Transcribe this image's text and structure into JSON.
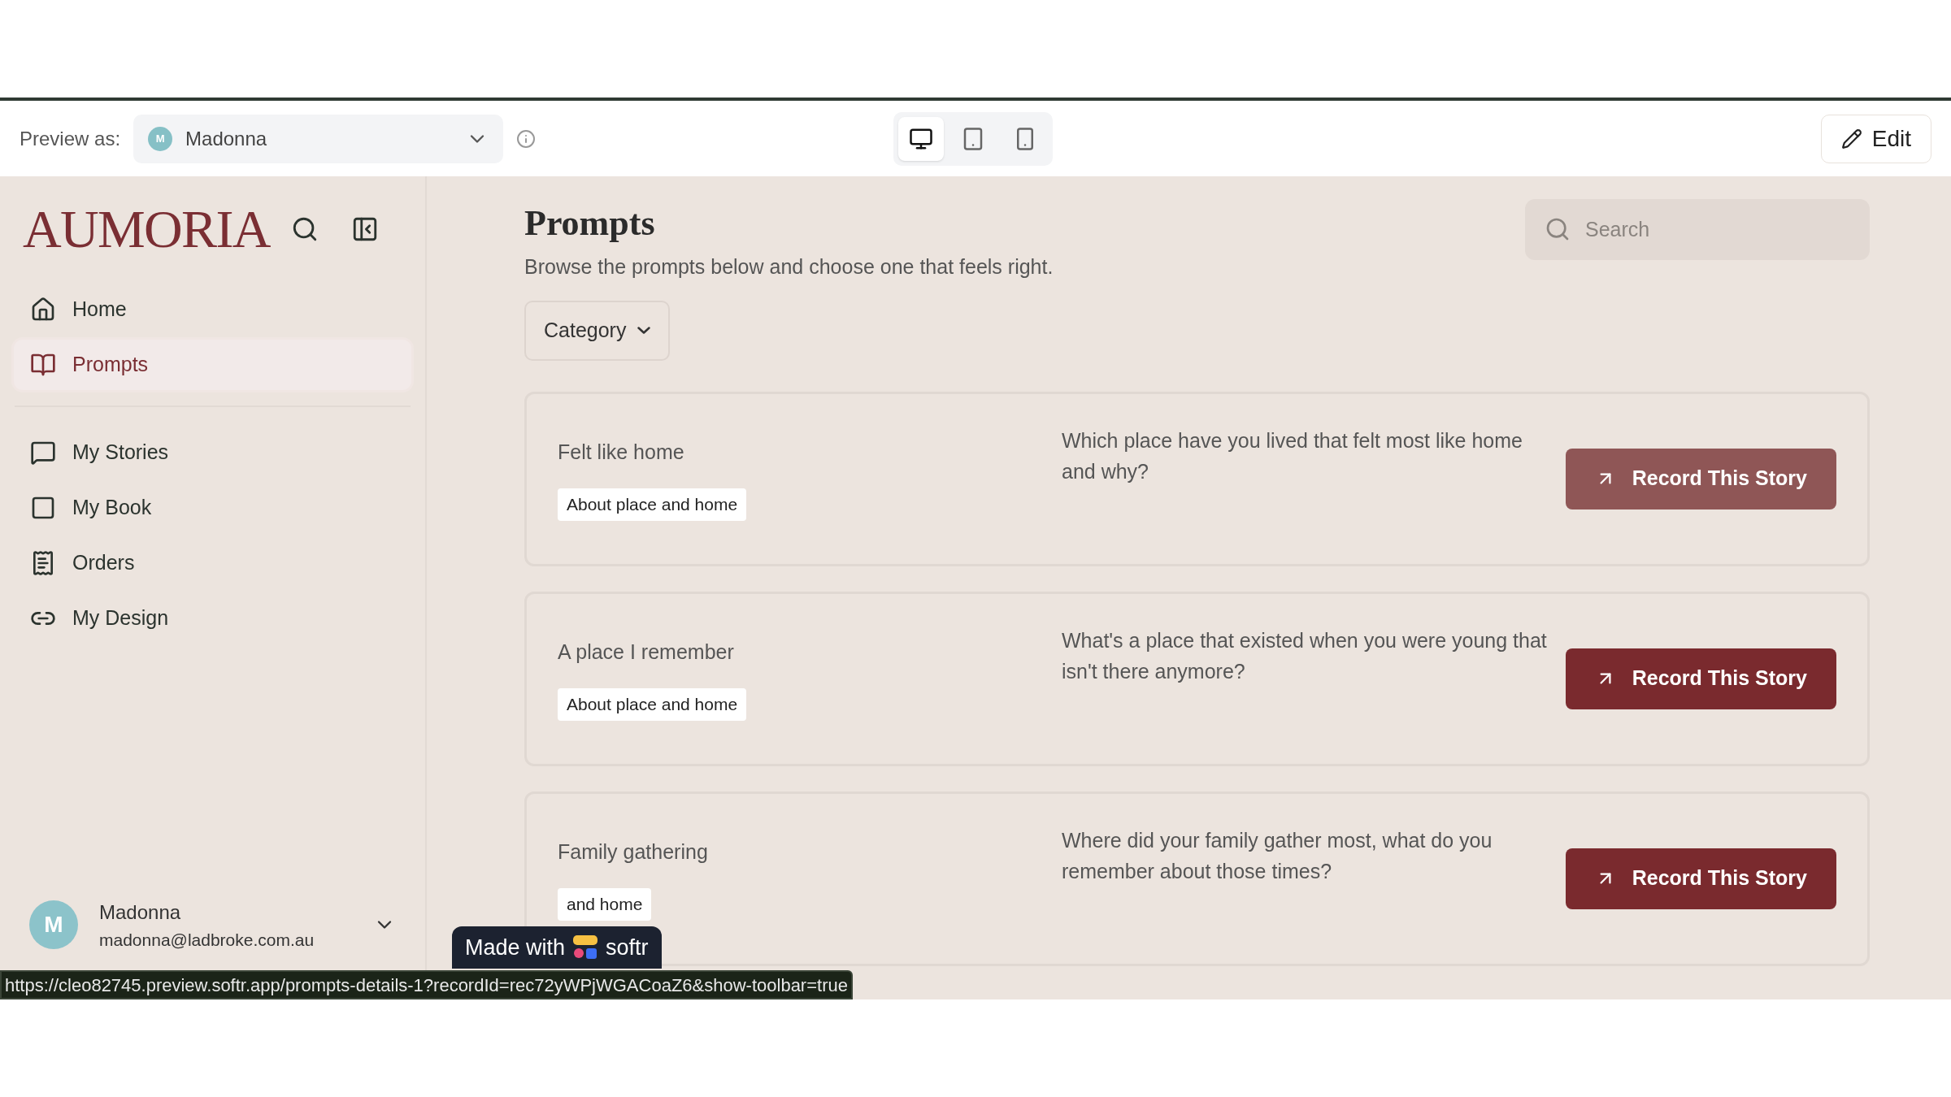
{
  "toolbar": {
    "preview_label": "Preview as:",
    "user_select": {
      "initial": "M",
      "name": "Madonna"
    },
    "devices": [
      {
        "kind": "desktop",
        "selected": true
      },
      {
        "kind": "tablet",
        "selected": false
      },
      {
        "kind": "phone",
        "selected": false
      }
    ],
    "edit_button": "Edit"
  },
  "sidebar": {
    "logo": "AUMORIA",
    "items": [
      {
        "label": "Home",
        "kind": "home",
        "selected": false
      },
      {
        "label": "Prompts",
        "kind": "book",
        "selected": true
      },
      {
        "label": "My Stories",
        "kind": "chat",
        "selected": false
      },
      {
        "label": "My Book",
        "kind": "square",
        "selected": false
      },
      {
        "label": "Orders",
        "kind": "receipt",
        "selected": false
      },
      {
        "label": "My Design",
        "kind": "link",
        "selected": false
      }
    ],
    "user": {
      "initial": "M",
      "name": "Madonna",
      "email": "madonna@ladbroke.com.au"
    }
  },
  "main": {
    "title": "Prompts",
    "subtitle": "Browse the prompts below and choose one that feels right.",
    "search": {
      "placeholder": "Search"
    },
    "category_button": "Category",
    "cards": [
      {
        "title": "Felt like home",
        "tag": "About place and home",
        "question": "Which place have you lived that felt most like home and why?",
        "button": "Record This Story",
        "hovered": true
      },
      {
        "title": "A place I remember",
        "tag": "About place and home",
        "question": "What's a place that existed when you were young that isn't there anymore?",
        "button": "Record This Story",
        "hovered": false
      },
      {
        "title": "Family gathering",
        "tag": "and home",
        "question": "Where did your family gather most, what do you remember about those times?",
        "button": "Record This Story",
        "hovered": false
      }
    ]
  },
  "badge": {
    "prefix": "Made with",
    "brand": "softr"
  },
  "status_url": "https://cleo82745.preview.softr.app/prompts-details-1?recordId=rec72yWPjWGACoaZ6&show-toolbar=true"
}
